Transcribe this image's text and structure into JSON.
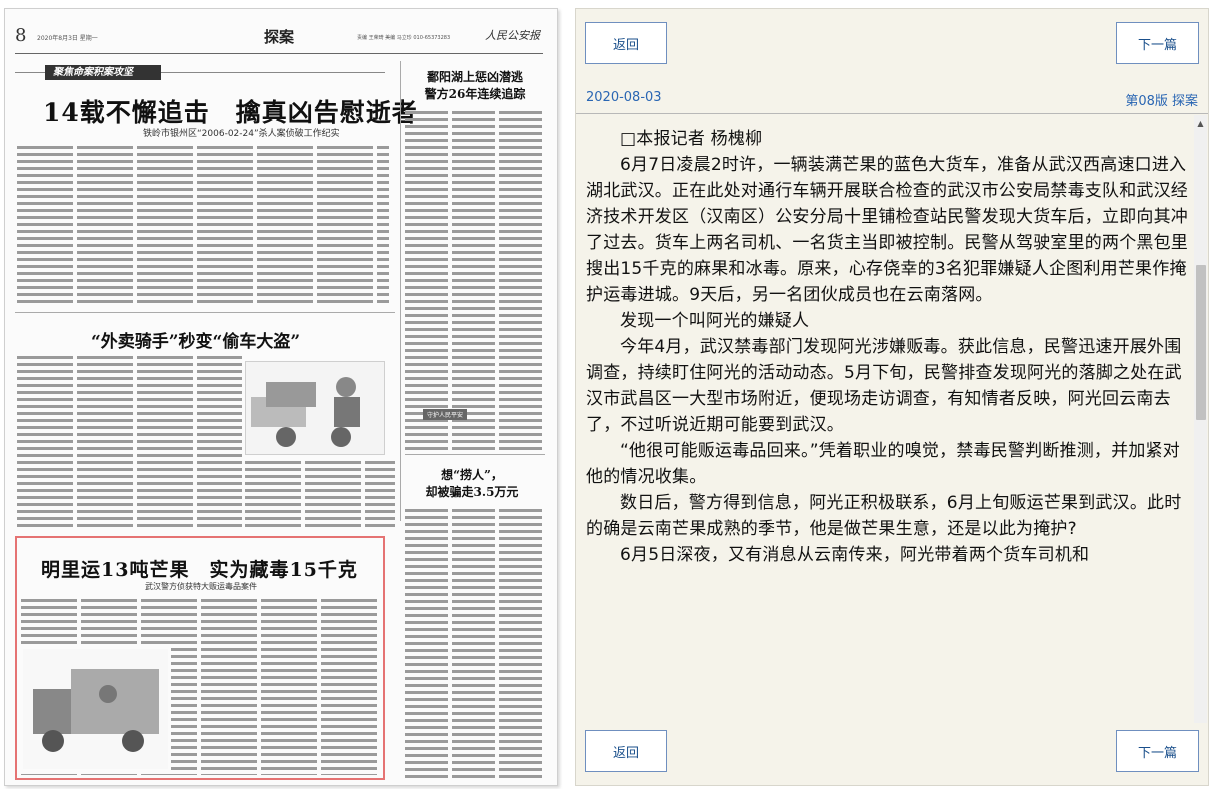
{
  "paper": {
    "page_number": "8",
    "date_line": "2020年8月3日 星期一",
    "section": "探案",
    "editor_line": "责编 王荣琦  美编 马立珍  010-65373283",
    "logo": "人民公安报",
    "banner": "聚焦命案积案攻坚",
    "headline_main": "14载不懈追击　擒真凶告慰逝者",
    "headline_main_sub": "铁岭市银州区“2006-02-24”杀人案侦破工作纪实",
    "headline_right": "鄱阳湖上惩凶潜逃\n警方26年连续追踪",
    "headline_middle": "“外卖骑手”秒变“偷车大盗”",
    "headline_right2": "想“捞人”，\n却被骗走3.5万元",
    "headline_bottom": "明里运13吨芒果　实为藏毒15千克",
    "headline_bottom_sub": "武汉警方侦获特大贩运毒品案件",
    "small_tag": "守护人民平安"
  },
  "reader": {
    "back_label": "返回",
    "next_label": "下一篇",
    "date": "2020-08-03",
    "page_info": "第08版 探案",
    "paragraphs": [
      "□本报记者 杨槐柳",
      "6月7日凌晨2时许，一辆装满芒果的蓝色大货车，准备从武汉西高速口进入湖北武汉。正在此处对通行车辆开展联合检查的武汉市公安局禁毒支队和武汉经济技术开发区（汉南区）公安分局十里铺检查站民警发现大货车后，立即向其冲了过去。货车上两名司机、一名货主当即被控制。民警从驾驶室里的两个黑包里搜出15千克的麻果和冰毒。原来，心存侥幸的3名犯罪嫌疑人企图利用芒果作掩护运毒进城。9天后，另一名团伙成员也在云南落网。",
      "发现一个叫阿光的嫌疑人",
      "今年4月，武汉禁毒部门发现阿光涉嫌贩毒。获此信息，民警迅速开展外围调查，持续盯住阿光的活动动态。5月下旬，民警排查发现阿光的落脚之处在武汉市武昌区一大型市场附近，便现场走访调查，有知情者反映，阿光回云南去了，不过听说近期可能要到武汉。",
      "“他很可能贩运毒品回来。”凭着职业的嗅觉，禁毒民警判断推测，并加紧对他的情况收集。",
      "数日后，警方得到信息，阿光正积极联系，6月上旬贩运芒果到武汉。此时的确是云南芒果成熟的季节，他是做芒果生意，还是以此为掩护?",
      "6月5日深夜，又有消息从云南传来，阿光带着两个货车司机和"
    ],
    "scroll_up_icon": "triangle-up-icon"
  }
}
